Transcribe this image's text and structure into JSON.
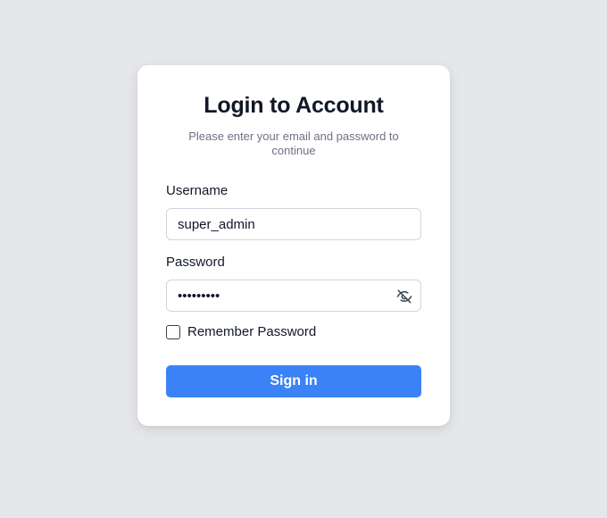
{
  "login": {
    "title": "Login to Account",
    "subtitle": "Please enter your email and password to continue",
    "username_label": "Username",
    "username_value": "super_admin",
    "password_label": "Password",
    "password_value": "•••••••••",
    "password_toggle_icon": "eye-off-icon",
    "remember_label": "Remember Password",
    "remember_checked": false,
    "signin_label": "Sign in"
  },
  "colors": {
    "background": "#e5e7eb",
    "card": "#ffffff",
    "primary_button": "#3b82f6"
  }
}
